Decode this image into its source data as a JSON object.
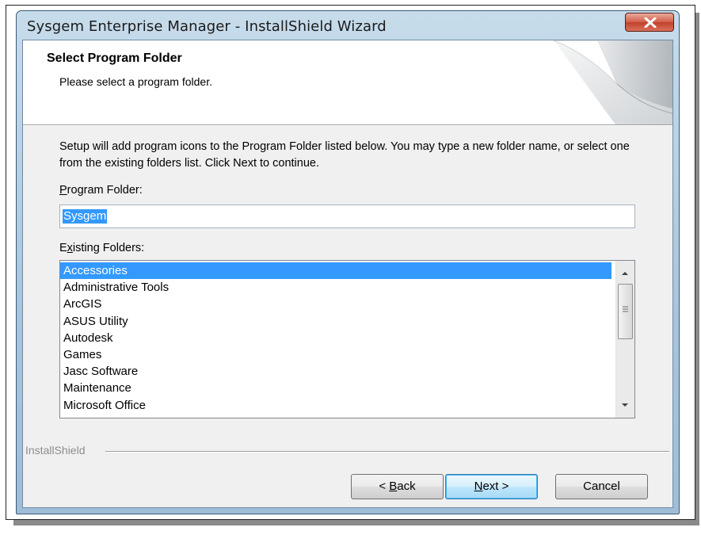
{
  "window": {
    "title": "Sysgem Enterprise Manager - InstallShield Wizard"
  },
  "header": {
    "title": "Select Program Folder",
    "subtitle": "Please select a program folder."
  },
  "body": {
    "description": "Setup will add program icons to the Program Folder listed below.  You may type a new folder name, or select one from the existing folders list.  Click Next to continue.",
    "program_folder_label": {
      "before": "",
      "accel": "P",
      "after": "rogram Folder:"
    },
    "program_folder_value": "Sysgem",
    "existing_folders_label": {
      "before": "E",
      "accel": "x",
      "after": "isting Folders:"
    },
    "folders": [
      "Accessories",
      "Administrative Tools",
      "ArcGIS",
      "ASUS Utility",
      "Autodesk",
      "Games",
      "Jasc Software",
      "Maintenance",
      "Microsoft Office"
    ],
    "selected_folder": "Accessories"
  },
  "footer": {
    "brand": "InstallShield",
    "back": {
      "before": "< ",
      "accel": "B",
      "after": "ack"
    },
    "next": {
      "before": "",
      "accel": "N",
      "after": "ext >"
    },
    "cancel": "Cancel"
  },
  "colors": {
    "selection": "#3399ff",
    "close_button": "#c2412c",
    "title_bar": "#a8c5dd"
  },
  "icons": {
    "close": "close-x-icon",
    "scroll_up": "arrow-up-icon",
    "scroll_down": "arrow-down-icon"
  }
}
